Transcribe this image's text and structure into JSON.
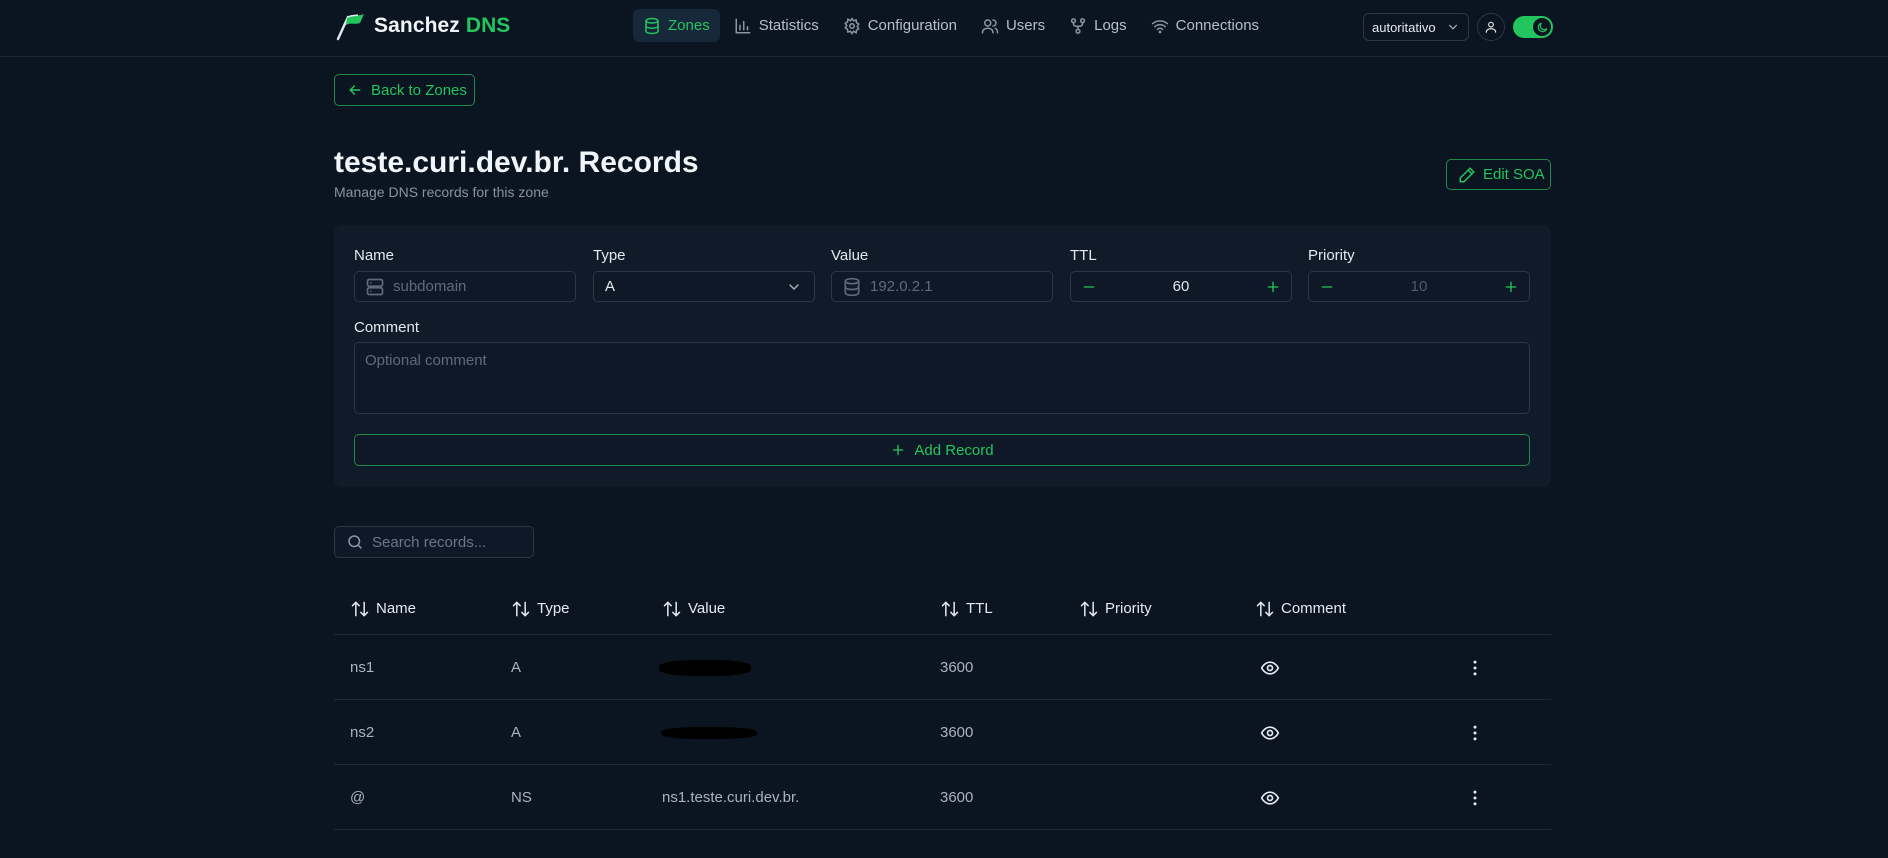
{
  "colors": {
    "background": "#0b1421",
    "card": "#101b2a",
    "accent": "#22c55e",
    "border": "#2b3746"
  },
  "brand": {
    "name": "Sanchez",
    "accent": "DNS",
    "logo_icon": "flag-logo-icon"
  },
  "nav": {
    "items": [
      {
        "label": "Zones",
        "icon": "database-icon",
        "active": true
      },
      {
        "label": "Statistics",
        "icon": "bar-chart-icon"
      },
      {
        "label": "Configuration",
        "icon": "gear-icon"
      },
      {
        "label": "Users",
        "icon": "users-icon"
      },
      {
        "label": "Logs",
        "icon": "git-fork-icon"
      },
      {
        "label": "Connections",
        "icon": "wifi-icon"
      }
    ],
    "mode_select": "autoritativo"
  },
  "back_label": "Back to Zones",
  "page": {
    "title": "teste.curi.dev.br. Records",
    "subtitle": "Manage DNS records for this zone",
    "edit_soa_label": "Edit SOA"
  },
  "form": {
    "name_label": "Name",
    "name_placeholder": "subdomain",
    "type_label": "Type",
    "type_value": "A",
    "value_label": "Value",
    "value_placeholder": "192.0.2.1",
    "ttl_label": "TTL",
    "ttl_value": "60",
    "priority_label": "Priority",
    "priority_value": "10",
    "comment_label": "Comment",
    "comment_placeholder": "Optional comment",
    "add_label": "Add Record"
  },
  "search_placeholder": "Search records...",
  "table": {
    "headers": [
      "Name",
      "Type",
      "Value",
      "TTL",
      "Priority",
      "Comment"
    ],
    "rows": [
      {
        "name": "ns1",
        "type": "A",
        "value": "",
        "ttl": "3600",
        "priority": ""
      },
      {
        "name": "ns2",
        "type": "A",
        "value": "",
        "ttl": "3600",
        "priority": ""
      },
      {
        "name": "@",
        "type": "NS",
        "value": "ns1.teste.curi.dev.br.",
        "ttl": "3600",
        "priority": ""
      }
    ]
  }
}
